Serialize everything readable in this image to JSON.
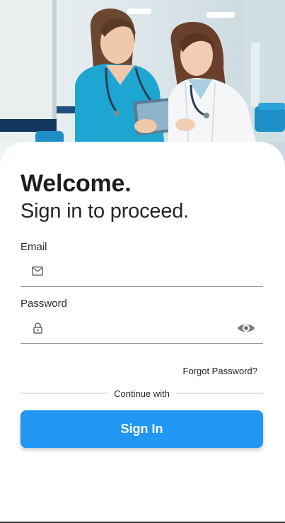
{
  "hero": {
    "image_description_icon": "doctors-photo",
    "colors": {
      "scrubs": "#1ea6d3",
      "coat": "#f4f6f8",
      "tablet": "#7fa6bd",
      "wall": "#dfe9ec"
    }
  },
  "login": {
    "title": "Welcome.",
    "subtitle": "Sign in to proceed.",
    "email": {
      "label": "Email",
      "value": "",
      "placeholder": "",
      "icon": "mail-icon"
    },
    "password": {
      "label": "Password",
      "value": "",
      "placeholder": "",
      "icon": "lock-icon",
      "toggle_icon": "eye-icon"
    },
    "forgot_password": "Forgot Password?",
    "divider_text": "Continue with",
    "sign_in_button": "Sign In"
  },
  "theme": {
    "accent": "#2196f3",
    "text": "#1d1d1d",
    "field_border": "#8e8e8e"
  }
}
